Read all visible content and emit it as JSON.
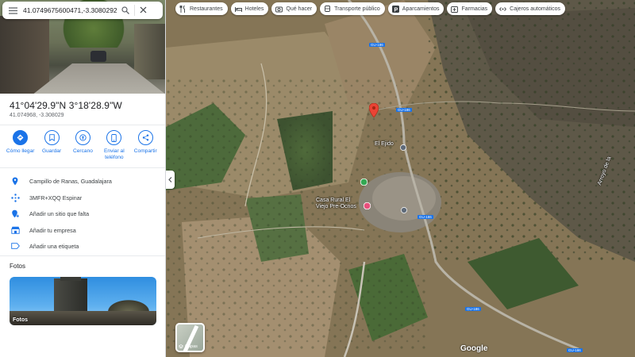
{
  "search": {
    "value": "41.0749675600471,-3.3080292",
    "menu_icon": "menu-icon",
    "search_icon": "search-icon",
    "close_icon": "close-icon"
  },
  "place": {
    "coords_dms": "41°04'29.9\"N 3°18'28.9\"W",
    "coords_decimal": "41.074968, -3.308029"
  },
  "actions": [
    {
      "label": "Cómo llegar",
      "icon": "directions-icon"
    },
    {
      "label": "Guardar",
      "icon": "bookmark-icon"
    },
    {
      "label": "Cercano",
      "icon": "nearby-icon"
    },
    {
      "label": "Enviar al teléfono",
      "icon": "phone-icon"
    },
    {
      "label": "Compartir",
      "icon": "share-icon"
    }
  ],
  "info": [
    {
      "text": "Campillo de Ranas, Guadalajara",
      "icon": "location-pin-icon"
    },
    {
      "text": "3MFR+XQQ Espinar",
      "icon": "plus-code-icon"
    },
    {
      "text": "Añadir un sitio que falta",
      "icon": "add-place-icon"
    },
    {
      "text": "Añadir tu empresa",
      "icon": "business-icon"
    },
    {
      "text": "Añadir una etiqueta",
      "icon": "label-icon"
    }
  ],
  "photos": {
    "title": "Fotos",
    "card_label": "Fotos"
  },
  "chips": [
    {
      "label": "Restaurantes",
      "icon": "restaurant-icon"
    },
    {
      "label": "Hoteles",
      "icon": "hotel-icon"
    },
    {
      "label": "Qué hacer",
      "icon": "camera-icon"
    },
    {
      "label": "Transporte público",
      "icon": "transit-icon"
    },
    {
      "label": "Aparcamientos",
      "icon": "parking-icon"
    },
    {
      "label": "Farmacias",
      "icon": "pharmacy-icon"
    },
    {
      "label": "Cajeros automáticos",
      "icon": "atm-icon"
    }
  ],
  "map": {
    "layers_label": "Capas",
    "google_logo": "Google",
    "labels": {
      "casa_rural": "Casa Rural El",
      "casa_rural_2": "Viejo Pre-Ocnos",
      "el_ejido": "El Ejido",
      "gu_station": "GU-186",
      "arroyo": "Arroyo de la"
    },
    "road_shields": [
      "GU-186",
      "GU-186",
      "GU-186",
      "GU-186",
      "GU-186"
    ]
  },
  "colors": {
    "accent": "#1a73e8",
    "pin": "#ea4335",
    "poi_green": "#34a853",
    "poi_pink": "#e8507c"
  }
}
